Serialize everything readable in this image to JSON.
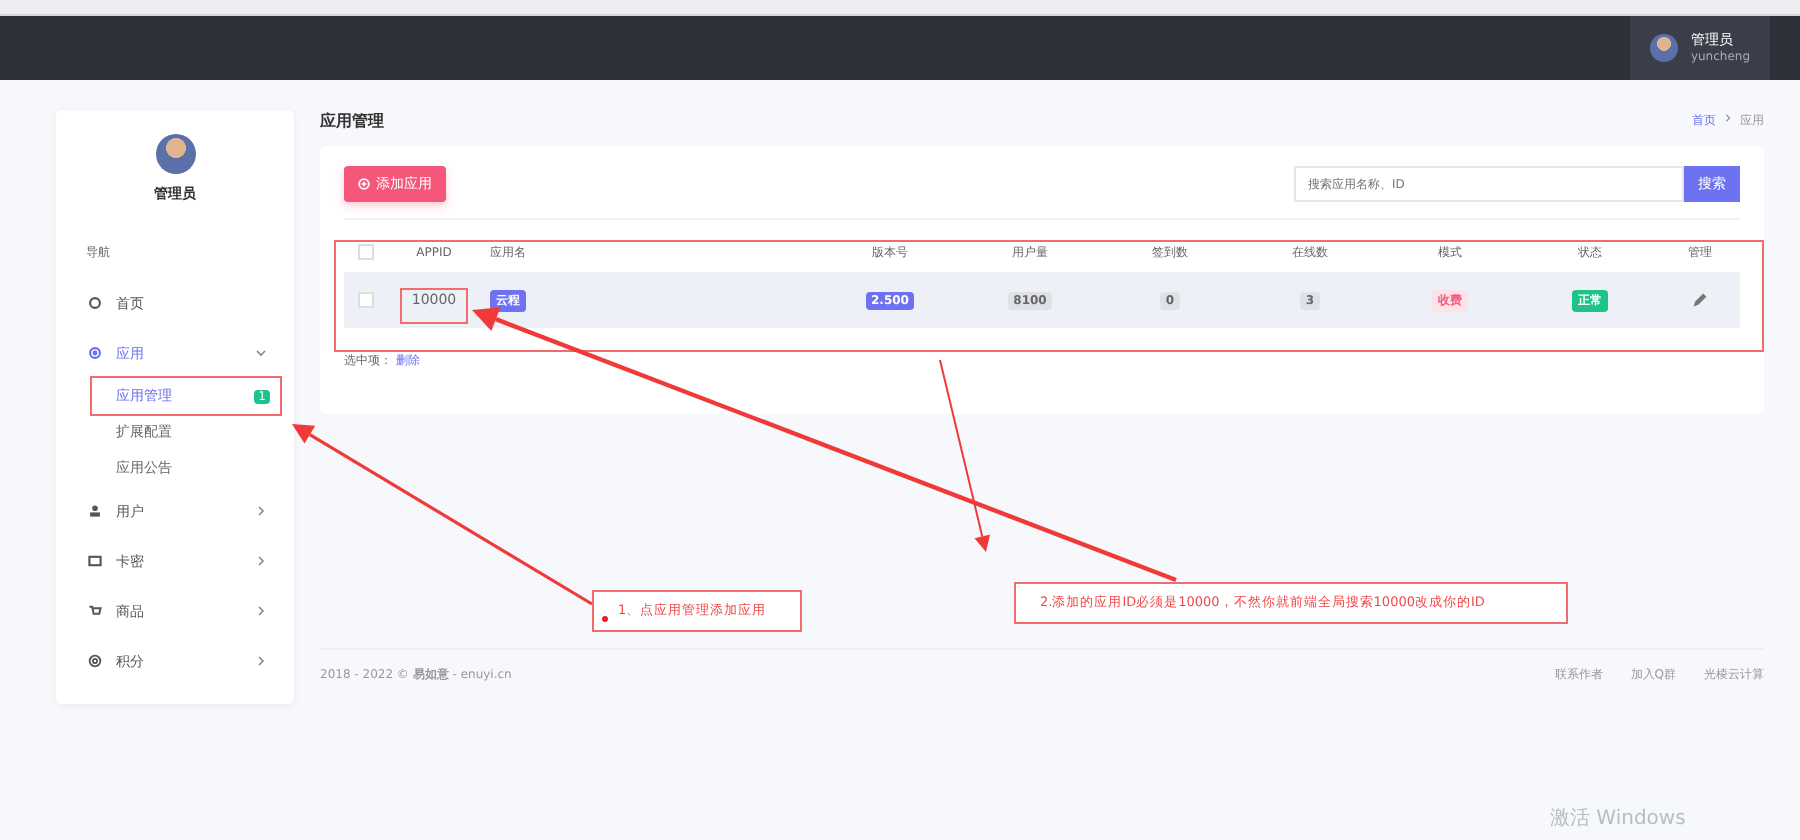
{
  "header": {
    "user_name": "管理员",
    "user_id": "yuncheng"
  },
  "sidebar": {
    "profile_name": "管理员",
    "section_label": "导航",
    "items": [
      {
        "label": "首页",
        "selected": false
      },
      {
        "label": "应用",
        "selected": true,
        "expanded": true,
        "children": [
          {
            "label": "应用管理",
            "selected": true,
            "badge": "1"
          },
          {
            "label": "扩展配置",
            "selected": false
          },
          {
            "label": "应用公告",
            "selected": false
          }
        ]
      },
      {
        "label": "用户",
        "selected": false,
        "expanded": false
      },
      {
        "label": "卡密",
        "selected": false,
        "expanded": false
      },
      {
        "label": "商品",
        "selected": false,
        "expanded": false
      },
      {
        "label": "积分",
        "selected": false,
        "expanded": false
      }
    ]
  },
  "page": {
    "title": "应用管理",
    "breadcrumb": [
      "首页",
      "应用"
    ]
  },
  "toolbar": {
    "add_button": "添加应用",
    "search_placeholder": "搜索应用名称、ID",
    "search_button": "搜索"
  },
  "table": {
    "all_checked": false,
    "columns": [
      "APPID",
      "应用名",
      "版本号",
      "用户量",
      "签到数",
      "在线数",
      "模式",
      "状态",
      "管理"
    ],
    "rows": [
      {
        "checked": false,
        "appid": "10000",
        "name": "云程",
        "version": "2.500",
        "users": "8100",
        "signins": "0",
        "online": "3",
        "mode": "收费",
        "status": "正常"
      }
    ]
  },
  "selection_bar": {
    "label": "选中项：",
    "action": "删除"
  },
  "annotations": [
    {
      "text": "1、点应用管理添加应用"
    },
    {
      "text": "2.添加的应用ID必须是10000，不然你就前端全局搜索10000改成你的ID"
    }
  ],
  "footer": {
    "copyright": "2018 - 2022 © **易如意** - enuyi.cn",
    "links": [
      "联系作者",
      "加入Q群",
      "光棱云计算"
    ]
  },
  "os_notice": "激活 Windows"
}
